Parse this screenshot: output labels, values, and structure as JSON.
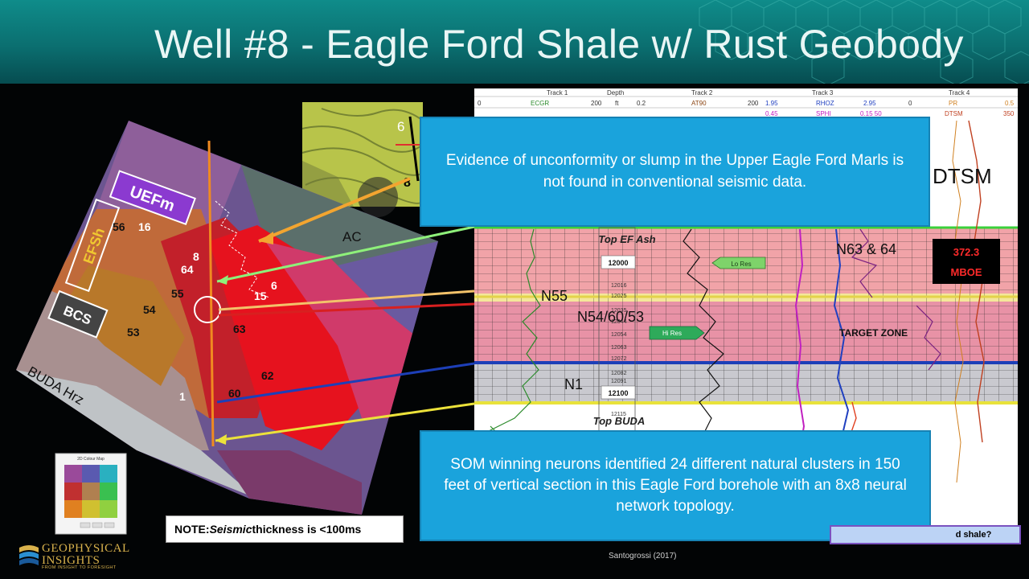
{
  "slide": {
    "title": "Well #8 - Eagle Ford Shale w/ Rust Geobody",
    "callout_top": "Evidence of unconformity or slump in the Upper Eagle Ford Marls is not found in conventional seismic data.",
    "callout_bottom": "SOM winning neurons identified 24 different natural clusters in 150 feet of  vertical section in this Eagle Ford borehole with an 8x8 neural network topology.",
    "note_label": "NOTE:",
    "note_italic": "Seismic",
    "note_rest": "thickness is <100ms",
    "citation": "Santogrossi (2017)",
    "bottom_tag": "d shale?"
  },
  "logo": {
    "name": "GEOPHYSICAL\nINSIGHTS",
    "tagline": "FROM INSIGHT TO FORESIGHT"
  },
  "map_panel": {
    "zone_labels": {
      "uefm": "UEFm",
      "efsh": "EFSh",
      "bcs": "BCS",
      "buda": "BUDA Hrz",
      "ac": "AC"
    },
    "neuron_labels": [
      "56",
      "16",
      "8",
      "64",
      "6",
      "15",
      "55",
      "54",
      "53",
      "63",
      "62",
      "1",
      "60"
    ],
    "inset_labels": [
      "6",
      "8"
    ],
    "legend_title": "2D Colour Map"
  },
  "log_panel": {
    "track_headers": [
      "Track 1",
      "Depth",
      "Track 2",
      "Track 3",
      "Track 4"
    ],
    "curve_names": [
      "ECGR",
      "ft",
      "AT90",
      "RHOZ",
      "PR",
      "SPHI",
      "DTSM"
    ],
    "curve_scales": [
      "0",
      "200",
      "0.2",
      "200",
      "1.95",
      "2.95",
      "0",
      "0.5",
      "0.45",
      "0.15 50",
      "350"
    ],
    "big_labels": {
      "dtsm": "DTSM"
    },
    "horizons": {
      "top_ef_ash": "Top EF Ash",
      "top_buda": "Top BUDA"
    },
    "neuron_labels": {
      "n63_64": "N63 & 64",
      "n55": "N55",
      "n54_60_53": "N54/60/53",
      "n1": "N1"
    },
    "depth_markers": [
      "12000",
      "12100"
    ],
    "depth_ticks": [
      "12016",
      "12025",
      "12035",
      "12044",
      "12054",
      "12063",
      "12072",
      "12082",
      "12091",
      "12115"
    ],
    "resolution_tags": {
      "lo": "Lo Res",
      "hi": "Hi Res"
    },
    "target_zone": "TARGET ZONE",
    "volume_value": "372.3",
    "volume_unit": "MBOE"
  },
  "colors": {
    "accent_callout": "#1aa3dc",
    "title_band": "#0b6f70",
    "zone_pink": "#f1a3a8",
    "zone_gray": "#c9c9cf",
    "volume_box": "#000000",
    "volume_text": "#ff2a2a"
  }
}
